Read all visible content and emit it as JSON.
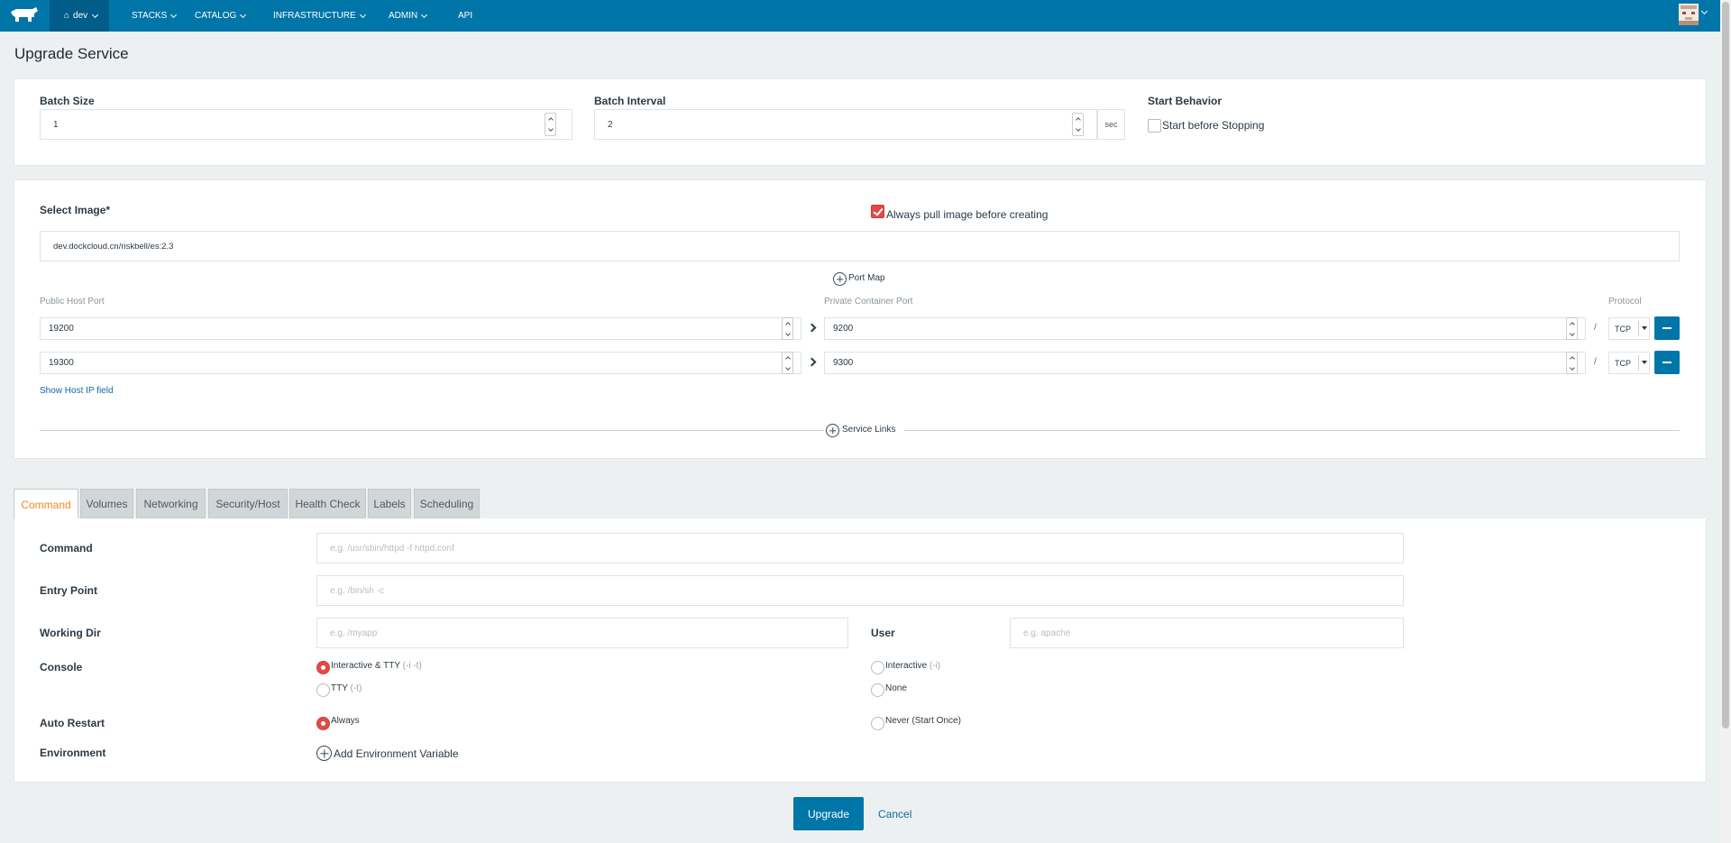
{
  "header": {
    "env": "dev",
    "nav": [
      "STACKS",
      "CATALOG",
      "INFRASTRUCTURE",
      "ADMIN",
      "API"
    ]
  },
  "page_title": "Upgrade Service",
  "upgrade": {
    "batch_size_label": "Batch Size",
    "batch_size": "1",
    "batch_interval_label": "Batch Interval",
    "batch_interval": "2",
    "batch_interval_unit": "sec",
    "start_behavior_label": "Start Behavior",
    "start_before_stopping": "Start before Stopping"
  },
  "image": {
    "label": "Select Image*",
    "value": "dev.dockcloud.cn/riskbell/es:2.3",
    "always_pull": "Always pull image before creating"
  },
  "ports": {
    "add_label": "Port Map",
    "public_label": "Public Host Port",
    "private_label": "Private Container Port",
    "protocol_label": "Protocol",
    "rows": [
      {
        "public": "19200",
        "private": "9200",
        "protocol": "TCP"
      },
      {
        "public": "19300",
        "private": "9300",
        "protocol": "TCP"
      }
    ],
    "separator": "/",
    "show_host_ip": "Show Host IP field"
  },
  "service_links": "Service Links",
  "tabs": [
    "Command",
    "Volumes",
    "Networking",
    "Security/Host",
    "Health Check",
    "Labels",
    "Scheduling"
  ],
  "command": {
    "command_label": "Command",
    "command_ph": "e.g. /usr/sbin/httpd -f httpd.conf",
    "entry_label": "Entry Point",
    "entry_ph": "e.g. /bin/sh -c",
    "workdir_label": "Working Dir",
    "workdir_ph": "e.g. /myapp",
    "user_label": "User",
    "user_ph": "e.g. apache",
    "console_label": "Console",
    "console_opt1": "Interactive & TTY",
    "console_opt1_hint": "(-i -t)",
    "console_opt2": "Interactive",
    "console_opt2_hint": "(-i)",
    "console_opt3": "TTY",
    "console_opt3_hint": "(-t)",
    "console_opt4": "None",
    "restart_label": "Auto Restart",
    "restart_opt1": "Always",
    "restart_opt2": "Never (Start Once)",
    "env_label": "Environment",
    "add_env": "Add Environment Variable"
  },
  "footer": {
    "upgrade": "Upgrade",
    "cancel": "Cancel"
  },
  "colors": {
    "brand": "#0075a8",
    "accent_red": "#e24a4a",
    "tab_active": "#f08a24"
  }
}
